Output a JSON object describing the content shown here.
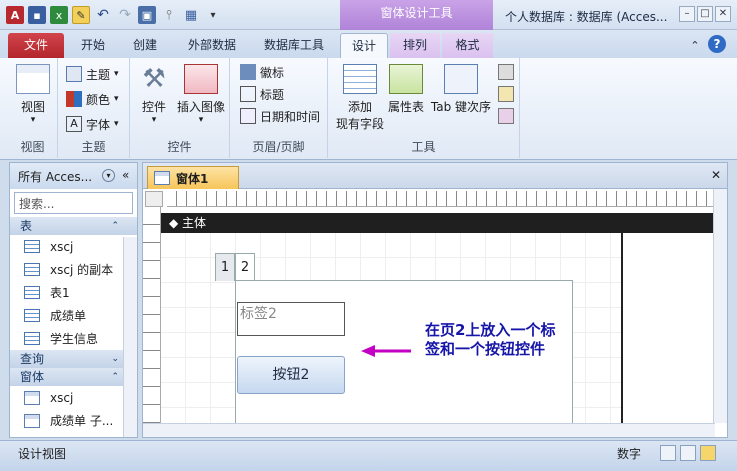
{
  "titlebar": {
    "app_icon_letter": "A",
    "contextual_group": "窗体设计工具",
    "window_title": "个人数据库 : 数据库 (Acces...",
    "minimize": "–",
    "maximize": "□",
    "close": "✕"
  },
  "tabs": {
    "file": "文件",
    "home": "开始",
    "create": "创建",
    "external": "外部数据",
    "dbtools": "数据库工具",
    "design": "设计",
    "arrange": "排列",
    "format": "格式"
  },
  "ribbon": {
    "views_label": "视图",
    "view_button": "视图",
    "themes_label": "主题",
    "theme_button": "主题",
    "color_button": "颜色",
    "font_button": "字体",
    "controls_label": "控件",
    "controls_button": "控件",
    "insert_image_button": "插入图像",
    "headerfooter_label": "页眉/页脚",
    "logo_button": "徽标",
    "title_button": "标题",
    "datetime_button": "日期和时间",
    "tools_label": "工具",
    "add_fields_line1": "添加",
    "add_fields_line2": "现有字段",
    "property_sheet_button": "属性表",
    "tab_order_button": "Tab 键次序"
  },
  "nav": {
    "header": "所有 Acces...",
    "search_placeholder": "搜索...",
    "cat_tables": "表",
    "cat_queries": "查询",
    "cat_forms": "窗体",
    "tables": [
      "xscj",
      "xscj 的副本",
      "表1",
      "成绩单",
      "学生信息"
    ],
    "forms": [
      "xscj",
      "成绩单 子..."
    ]
  },
  "document": {
    "tab_label": "窗体1",
    "section": "主体",
    "page_tab_1": "1",
    "page_tab_2": "2",
    "label_control": "标签2",
    "button_control": "按钮2",
    "annotation": "在页2上放入一个标签和一个按钮控件"
  },
  "status": {
    "left": "设计视图",
    "mode": "数字"
  }
}
